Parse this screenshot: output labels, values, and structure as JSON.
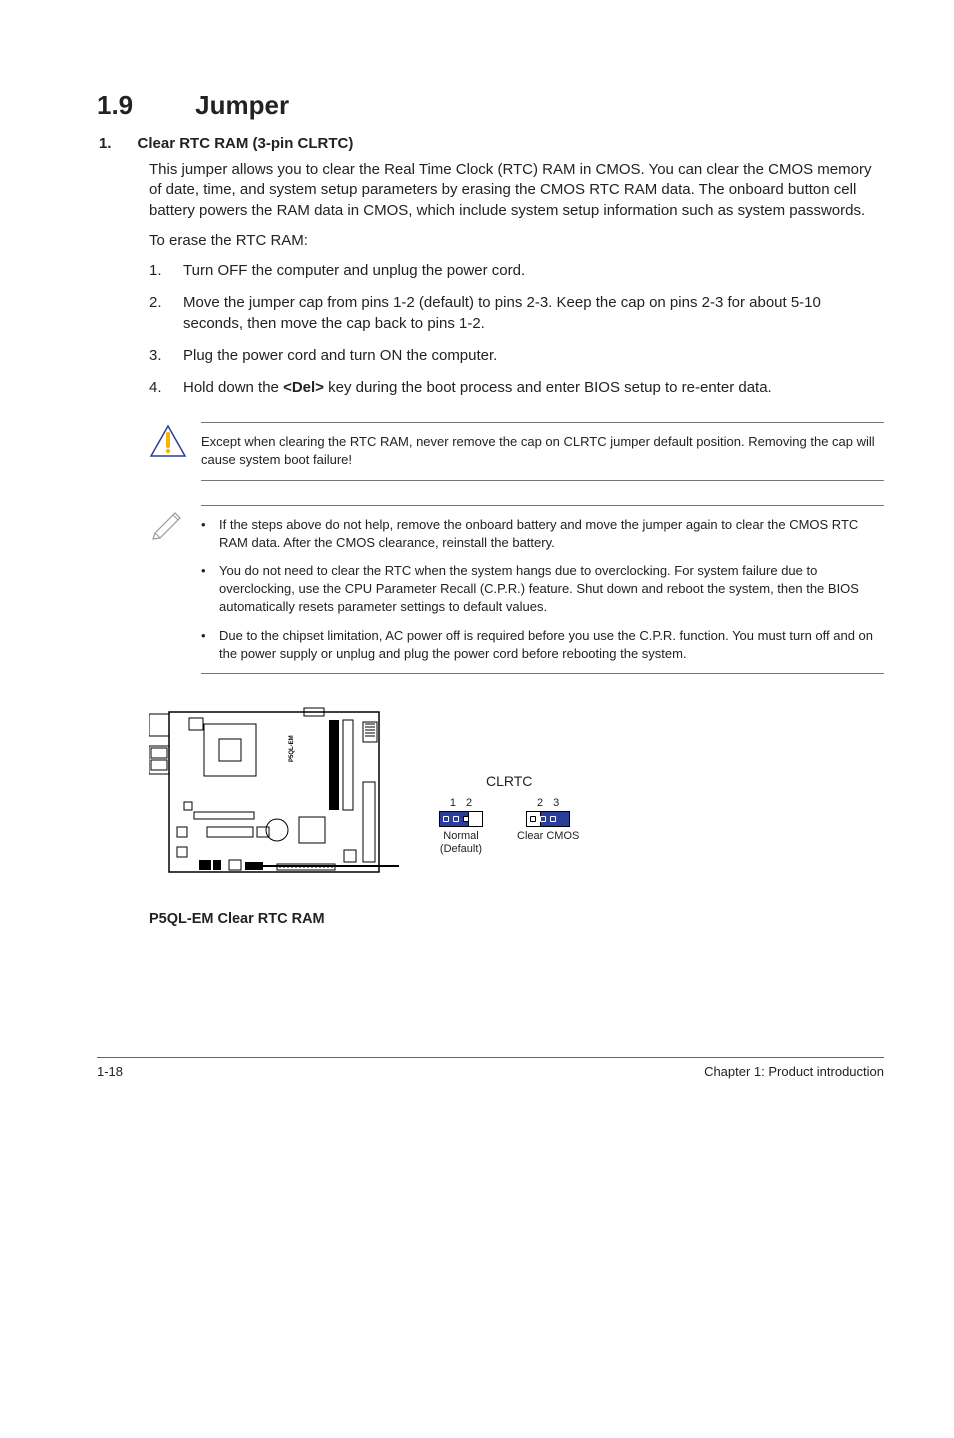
{
  "section": {
    "number": "1.9",
    "title": "Jumper"
  },
  "subsection": {
    "number": "1.",
    "title": "Clear RTC RAM (3-pin CLRTC)"
  },
  "paragraphs": {
    "intro": "This jumper allows you to clear the Real Time Clock (RTC) RAM in CMOS. You can clear the CMOS memory of date, time, and system setup parameters by erasing the CMOS RTC RAM data. The onboard button cell battery powers the RAM data in CMOS, which include system setup information such as system passwords.",
    "erase": "To erase the RTC RAM:"
  },
  "steps": [
    {
      "num": "1.",
      "text": "Turn OFF the computer and unplug the power cord."
    },
    {
      "num": "2.",
      "text": "Move the jumper cap from pins 1-2 (default) to pins 2-3. Keep the cap on pins 2-3 for about 5-10 seconds, then move the cap back to pins 1-2."
    },
    {
      "num": "3.",
      "text": "Plug the power cord and turn ON the computer."
    },
    {
      "num": "4.",
      "pre": "Hold down the ",
      "bold": "<Del>",
      "post": " key during the boot process and enter BIOS setup to re-enter data."
    }
  ],
  "caution": "Except when clearing the RTC RAM, never remove the cap on CLRTC jumper default position. Removing the cap will cause system boot failure!",
  "notes": [
    "If the steps above do not help, remove the onboard battery and move the jumper again to clear the CMOS RTC RAM data. After the CMOS clearance, reinstall the battery.",
    "You do not need to clear the RTC when the system hangs due to overclocking. For system failure due to overclocking, use the CPU Parameter Recall (C.P.R.) feature. Shut down and reboot the system, then the BIOS automatically resets parameter settings to default values.",
    "Due to the chipset limitation, AC power off is required before you use the C.P.R. function. You must turn off and on the power supply or unplug and plug the power cord before rebooting the system."
  ],
  "diagram": {
    "caption": "P5QL-EM Clear RTC RAM",
    "title": "CLRTC",
    "left": {
      "pins": [
        "1",
        "2"
      ],
      "label": "Normal",
      "sub": "(Default)"
    },
    "right": {
      "pins": [
        "2",
        "3"
      ],
      "label": "Clear CMOS"
    },
    "board_label": "P5QL-EM"
  },
  "footer": {
    "left": "1-18",
    "right": "Chapter 1: Product introduction"
  }
}
